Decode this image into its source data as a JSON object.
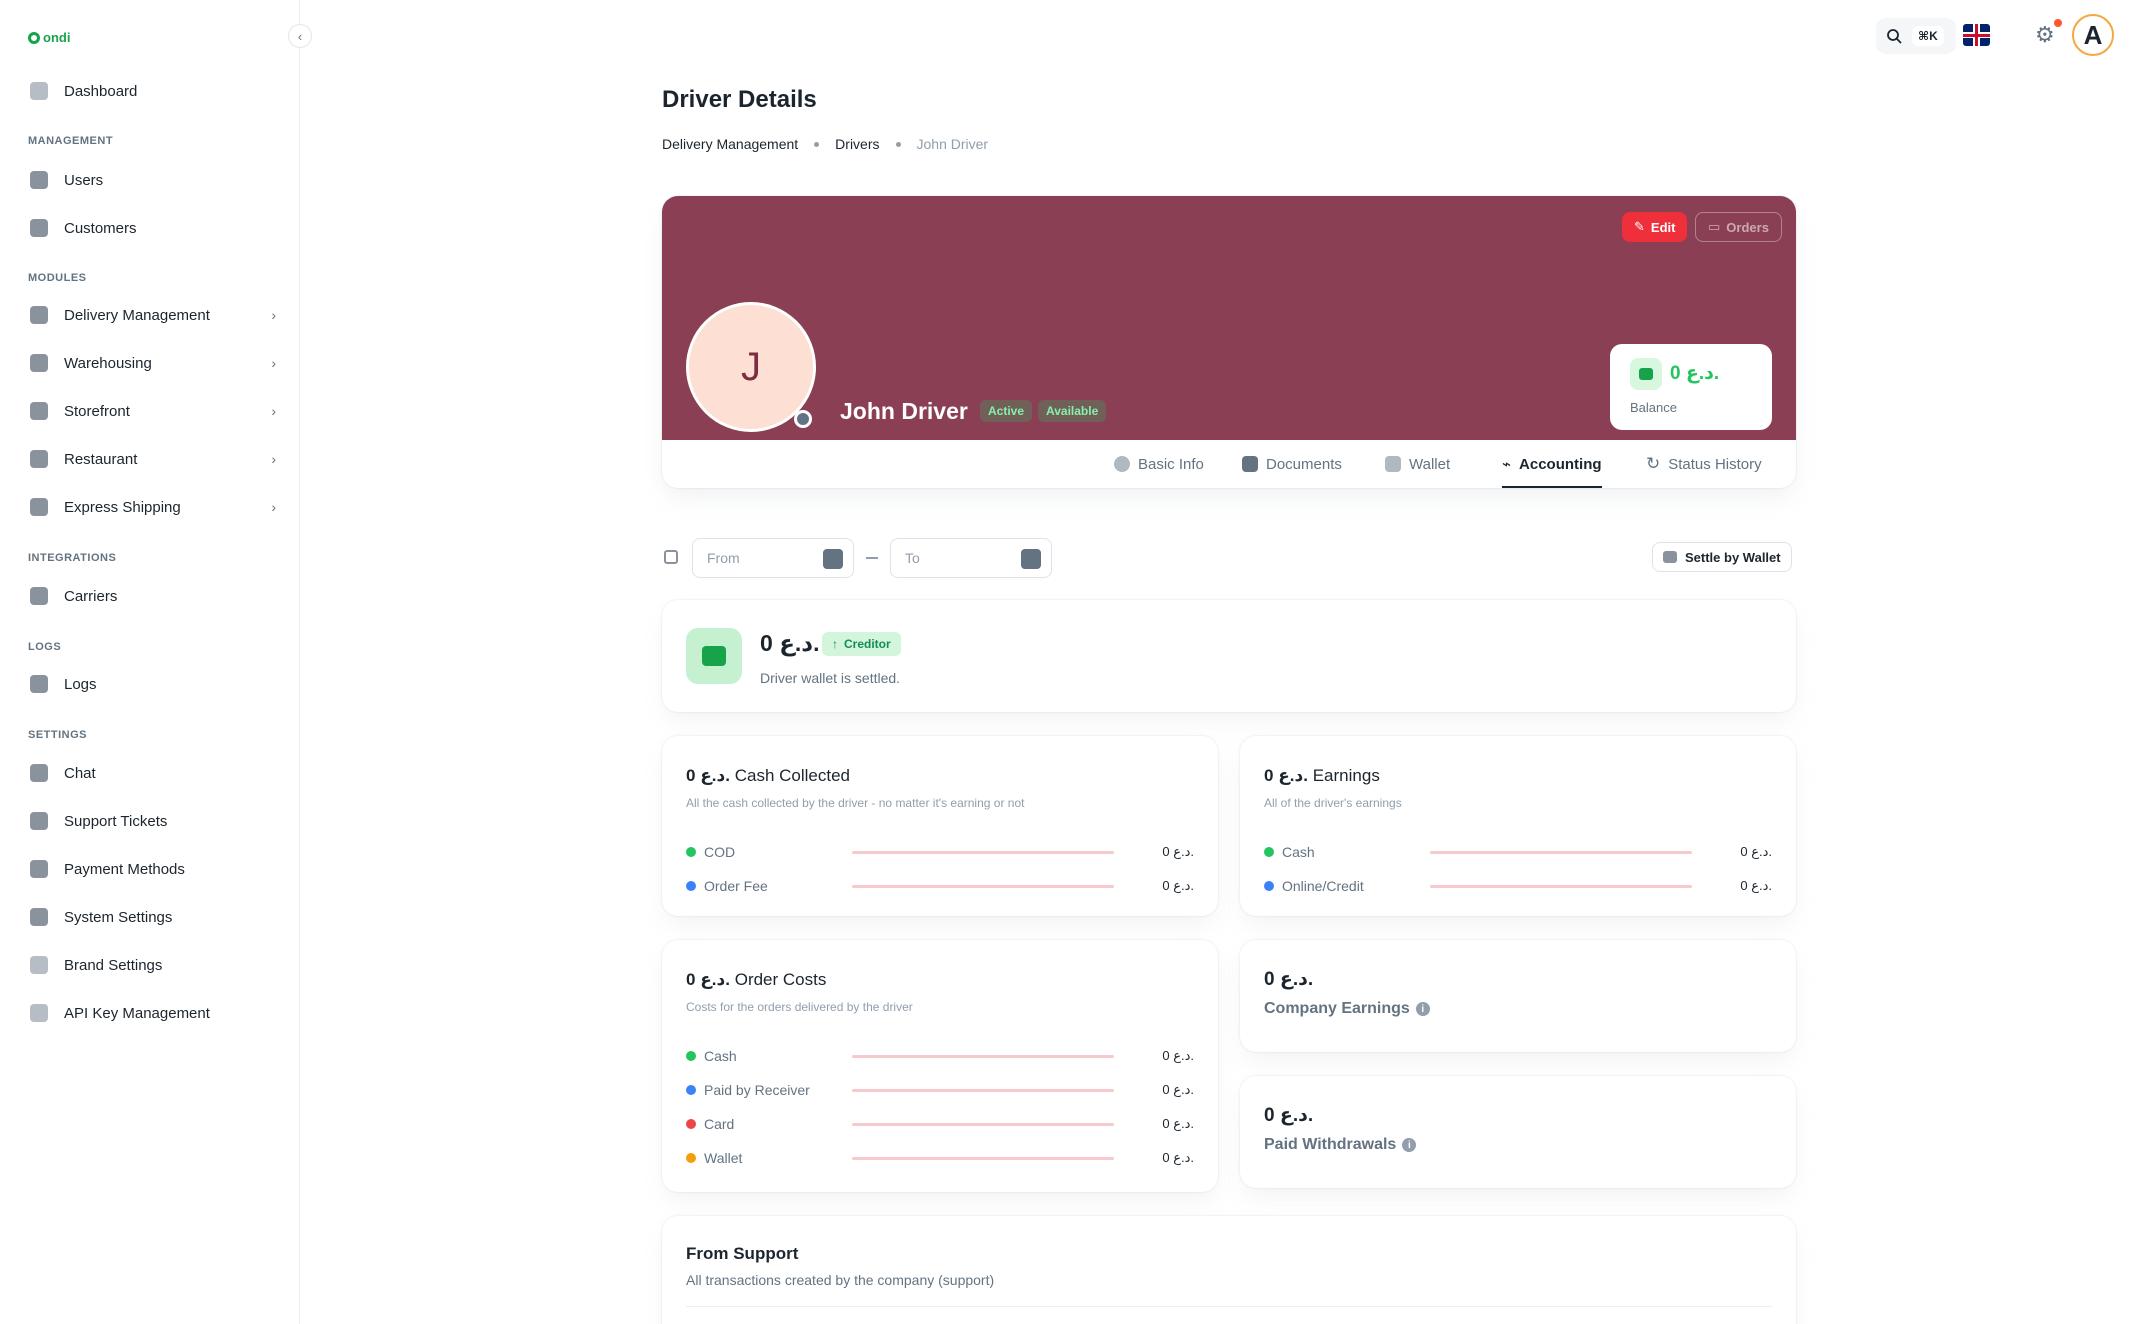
{
  "brand": {
    "logo_text": "ondi"
  },
  "sidebar": {
    "dashboard": "Dashboard",
    "sections": {
      "management": "MANAGEMENT",
      "modules": "MODULES",
      "integrations": "INTEGRATIONS",
      "logs": "LOGS",
      "settings": "SETTINGS"
    },
    "items": {
      "users": "Users",
      "customers": "Customers",
      "delivery": "Delivery Management",
      "warehousing": "Warehousing",
      "storefront": "Storefront",
      "restaurant": "Restaurant",
      "express": "Express Shipping",
      "carriers": "Carriers",
      "logs": "Logs",
      "chat": "Chat",
      "support": "Support Tickets",
      "payment": "Payment Methods",
      "system": "System Settings",
      "brand": "Brand Settings",
      "api": "API Key Management"
    }
  },
  "topbar": {
    "shortcut": "⌘K",
    "avatar_letter": "A"
  },
  "page": {
    "title": "Driver Details",
    "breadcrumb": [
      "Delivery Management",
      "Drivers",
      "John Driver"
    ]
  },
  "profile": {
    "initial": "J",
    "name": "John Driver",
    "badges": [
      "Active",
      "Available"
    ],
    "edit_label": "Edit",
    "orders_label": "Orders",
    "balance_value": "0 د.ع.",
    "balance_label": "Balance",
    "tabs": [
      "Basic Info",
      "Documents",
      "Wallet",
      "Accounting",
      "Status History"
    ],
    "active_tab": "Accounting"
  },
  "filters": {
    "from_placeholder": "From",
    "to_placeholder": "To",
    "settle_label": "Settle by Wallet"
  },
  "wallet_summary": {
    "amount": "0 د.ع.",
    "status": "Creditor",
    "message": "Driver wallet is settled."
  },
  "cash_collected": {
    "amount": "0 د.ع.",
    "title": "Cash Collected",
    "desc": "All the cash collected by the driver - no matter it's earning or not",
    "rows": [
      {
        "label": "COD",
        "value": "0 د.ع.",
        "color": "#22c55e"
      },
      {
        "label": "Order Fee",
        "value": "0 د.ع.",
        "color": "#3b82f6"
      }
    ]
  },
  "earnings": {
    "amount": "0 د.ع.",
    "title": "Earnings",
    "desc": "All of the driver's earnings",
    "rows": [
      {
        "label": "Cash",
        "value": "0 د.ع.",
        "color": "#22c55e"
      },
      {
        "label": "Online/Credit",
        "value": "0 د.ع.",
        "color": "#3b82f6"
      }
    ]
  },
  "order_costs": {
    "amount": "0 د.ع.",
    "title": "Order Costs",
    "desc": "Costs for the orders delivered by the driver",
    "rows": [
      {
        "label": "Cash",
        "value": "0 د.ع.",
        "color": "#22c55e"
      },
      {
        "label": "Paid by Receiver",
        "value": "0 د.ع.",
        "color": "#3b82f6"
      },
      {
        "label": "Card",
        "value": "0 د.ع.",
        "color": "#ef4444"
      },
      {
        "label": "Wallet",
        "value": "0 د.ع.",
        "color": "#f59e0b"
      }
    ]
  },
  "company_earnings": {
    "amount": "0 د.ع.",
    "label": "Company Earnings"
  },
  "paid_withdrawals": {
    "amount": "0 د.ع.",
    "label": "Paid Withdrawals"
  },
  "from_support": {
    "title": "From Support",
    "desc": "All transactions created by the company (support)"
  }
}
